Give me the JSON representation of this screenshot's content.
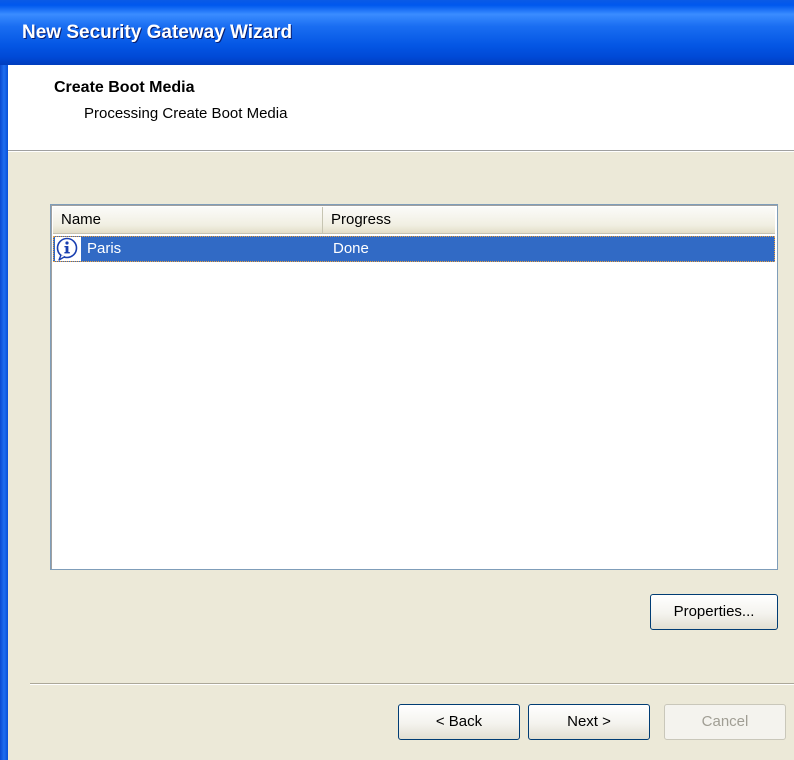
{
  "window": {
    "title": "New Security Gateway Wizard"
  },
  "header": {
    "title": "Create Boot Media",
    "subtitle": "Processing Create Boot Media"
  },
  "list": {
    "columns": [
      "Name",
      "Progress"
    ],
    "rows": [
      {
        "icon": "info-icon",
        "name": "Paris",
        "progress": "Done",
        "selected": true
      }
    ]
  },
  "buttons": {
    "properties": "Properties...",
    "back": "< Back",
    "next": "Next >",
    "cancel": "Cancel"
  },
  "colors": {
    "titlebar": "#0058ee",
    "selection": "#316AC5",
    "dialog_bg": "#ECE9D8"
  }
}
